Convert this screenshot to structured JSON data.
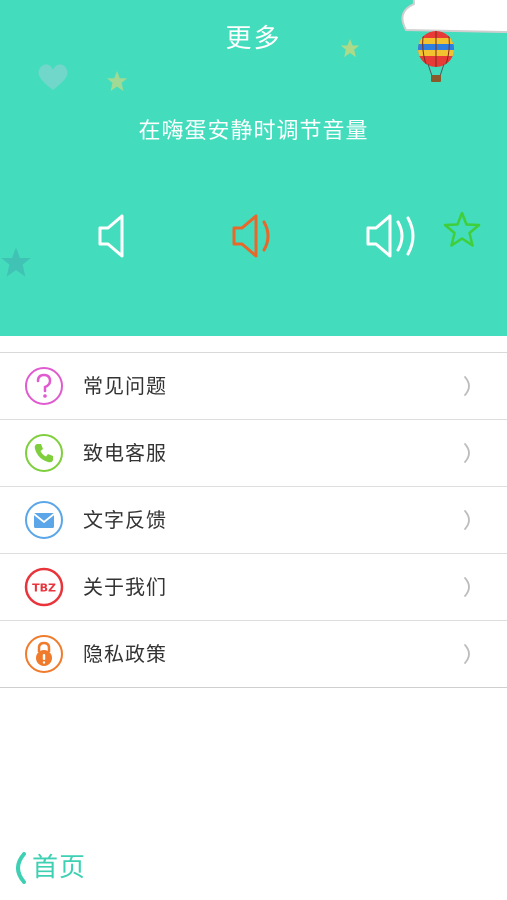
{
  "header": {
    "title": "更多",
    "hint": "在嗨蛋安静时调节音量",
    "background_color": "#43dcbd",
    "volume_levels": [
      {
        "name": "mute",
        "icon": "speaker-mute-icon",
        "selected": false
      },
      {
        "name": "medium",
        "icon": "speaker-medium-icon",
        "selected": true
      },
      {
        "name": "high",
        "icon": "speaker-high-icon",
        "selected": false
      }
    ],
    "selected_color": "#e8672a"
  },
  "menu": {
    "items": [
      {
        "label": "常见问题",
        "icon": "question-icon",
        "color": "#e05bd0"
      },
      {
        "label": "致电客服",
        "icon": "phone-icon",
        "color": "#7fcf3c"
      },
      {
        "label": "文字反馈",
        "icon": "mail-icon",
        "color": "#5aa6e8"
      },
      {
        "label": "关于我们",
        "icon": "tbz-logo-icon",
        "color": "#e8343a",
        "icon_text": "TBZ"
      },
      {
        "label": "隐私政策",
        "icon": "lock-icon",
        "color": "#f07b2c"
      }
    ]
  },
  "footer": {
    "back_label": "首页",
    "accent_color": "#3dd0b2"
  }
}
